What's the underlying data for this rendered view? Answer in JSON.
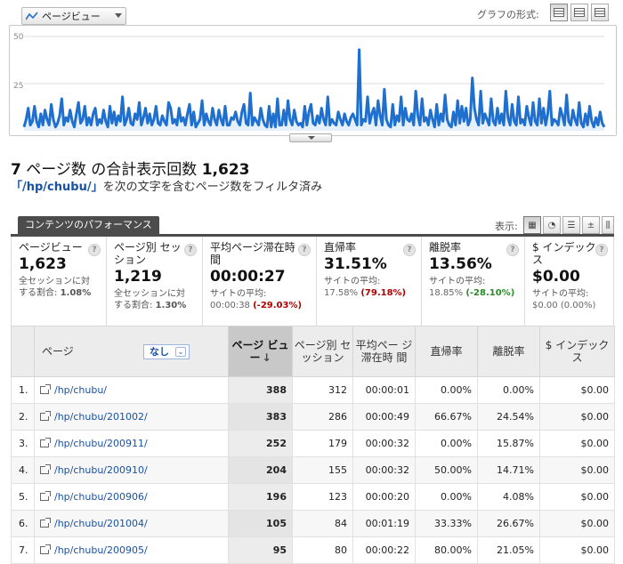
{
  "toolbar": {
    "metric_select": "ページビュー",
    "graph_format_label": "グラフの形式:"
  },
  "chart_data": {
    "type": "line",
    "ylim": [
      0,
      50
    ],
    "yticks": [
      "50",
      "25"
    ],
    "color": "#1f6fcf",
    "values": [
      2,
      6,
      12,
      3,
      5,
      13,
      5,
      2,
      9,
      3,
      11,
      6,
      3,
      14,
      6,
      2,
      4,
      8,
      17,
      3,
      7,
      5,
      11,
      5,
      2,
      9,
      15,
      4,
      6,
      13,
      3,
      7,
      3,
      9,
      12,
      3,
      6,
      4,
      11,
      5,
      2,
      13,
      4,
      10,
      3,
      8,
      5,
      18,
      3,
      6,
      12,
      4,
      3,
      9,
      6,
      15,
      3,
      7,
      12,
      4,
      9,
      3,
      6,
      13,
      4,
      3,
      8,
      5,
      3,
      15,
      12,
      4,
      6,
      3,
      12,
      5,
      7,
      3,
      9,
      14,
      3,
      10,
      2,
      4,
      6,
      16,
      3,
      9,
      5,
      3,
      12,
      6,
      3,
      11,
      6,
      3,
      13,
      3,
      3,
      7,
      6,
      10,
      5,
      3,
      10,
      14,
      4,
      3,
      20,
      3,
      7,
      5,
      3,
      12,
      6,
      3,
      2,
      13,
      2,
      9,
      2,
      17,
      3,
      3,
      11,
      3,
      16,
      6,
      3,
      11,
      5,
      3,
      4,
      2,
      13,
      3,
      10,
      14,
      4,
      3,
      8,
      4,
      12,
      6,
      3,
      18,
      3,
      6,
      4,
      3,
      10,
      6,
      3,
      9,
      5,
      3,
      7,
      9,
      6,
      3,
      43,
      3,
      6,
      5,
      18,
      4,
      9,
      12,
      3,
      16,
      8,
      3,
      22,
      6,
      3,
      2,
      14,
      3,
      8,
      5,
      18,
      3,
      12,
      6,
      5,
      9,
      3,
      21,
      8,
      3,
      17,
      5,
      7,
      3,
      11,
      6,
      2,
      14,
      3,
      9,
      5,
      19,
      6,
      3,
      2,
      10,
      3,
      16,
      4,
      13,
      5,
      12,
      3,
      6,
      28,
      12,
      6,
      3,
      21,
      4,
      9,
      6,
      3,
      17,
      5,
      3,
      12,
      4,
      9,
      3,
      21,
      7,
      3,
      14,
      5,
      3,
      18,
      4,
      6,
      3,
      13,
      7,
      3,
      15,
      5,
      3,
      17,
      4,
      12,
      3,
      9,
      21,
      3,
      6,
      5,
      3,
      12,
      8,
      3,
      19,
      5,
      3,
      11,
      6,
      3,
      15,
      4,
      2,
      9,
      3,
      13,
      5,
      2,
      7,
      3,
      10,
      4,
      2
    ]
  },
  "heading": {
    "count_prefix": "7",
    "count_middle": " ページ数 の合計表示回数 ",
    "total": "1,623",
    "filter_value": "「/hp/chubu/」",
    "filter_text": "を次の文字を含むページ数をフィルタ済み"
  },
  "tab": {
    "label": "コンテンツのパフォーマンス",
    "view_label": "表示:"
  },
  "summary": [
    {
      "label": "ページビュー",
      "value": "1,623",
      "sub1": "全セッションに対",
      "sub2_prefix": "する割合: ",
      "sub2_value": "1.08%"
    },
    {
      "label": "ページ別 セッション",
      "value": "1,219",
      "sub1": "全セッションに対",
      "sub2_prefix": "する割合: ",
      "sub2_value": "1.30%"
    },
    {
      "label": "平均ページ滞在時間",
      "value": "00:00:27",
      "sub1": "サイトの平均:",
      "avg": "00:00:38",
      "diff": "(-29.03%)"
    },
    {
      "label": "直帰率",
      "value": "31.51%",
      "sub1": "サイトの平均:",
      "avg": "17.58%",
      "diff": "(79.18%)"
    },
    {
      "label": "離脱率",
      "value": "13.56%",
      "sub1": "サイトの平均:",
      "avg": "18.85%",
      "diff": "(-28.10%)"
    },
    {
      "label": "$ インデックス",
      "value": "$0.00",
      "sub1": "サイトの平均:",
      "avg": "$0.00",
      "diff": "(0.00%)"
    }
  ],
  "table": {
    "headers": {
      "page": "ページ",
      "secondary_dim": "なし",
      "pageviews": "ページ ビュー",
      "sessions": "ページ別 セッション",
      "avg_time": "平均ペー ジ滞在時 間",
      "bounce": "直帰率",
      "exit": "離脱率",
      "index": "$ インデックス"
    },
    "rows": [
      {
        "idx": "1.",
        "page": "/hp/chubu/",
        "pv": "388",
        "sess": "312",
        "time": "00:00:01",
        "bounce": "0.00%",
        "exit": "0.00%",
        "index": "$0.00"
      },
      {
        "idx": "2.",
        "page": "/hp/chubu/201002/",
        "pv": "383",
        "sess": "286",
        "time": "00:00:49",
        "bounce": "66.67%",
        "exit": "24.54%",
        "index": "$0.00"
      },
      {
        "idx": "3.",
        "page": "/hp/chubu/200911/",
        "pv": "252",
        "sess": "179",
        "time": "00:00:32",
        "bounce": "0.00%",
        "exit": "15.87%",
        "index": "$0.00"
      },
      {
        "idx": "4.",
        "page": "/hp/chubu/200910/",
        "pv": "204",
        "sess": "155",
        "time": "00:00:32",
        "bounce": "50.00%",
        "exit": "14.71%",
        "index": "$0.00"
      },
      {
        "idx": "5.",
        "page": "/hp/chubu/200906/",
        "pv": "196",
        "sess": "123",
        "time": "00:00:20",
        "bounce": "0.00%",
        "exit": "4.08%",
        "index": "$0.00"
      },
      {
        "idx": "6.",
        "page": "/hp/chubu/201004/",
        "pv": "105",
        "sess": "84",
        "time": "00:01:19",
        "bounce": "33.33%",
        "exit": "26.67%",
        "index": "$0.00"
      },
      {
        "idx": "7.",
        "page": "/hp/chubu/200905/",
        "pv": "95",
        "sess": "80",
        "time": "00:00:22",
        "bounce": "80.00%",
        "exit": "21.05%",
        "index": "$0.00"
      }
    ]
  }
}
